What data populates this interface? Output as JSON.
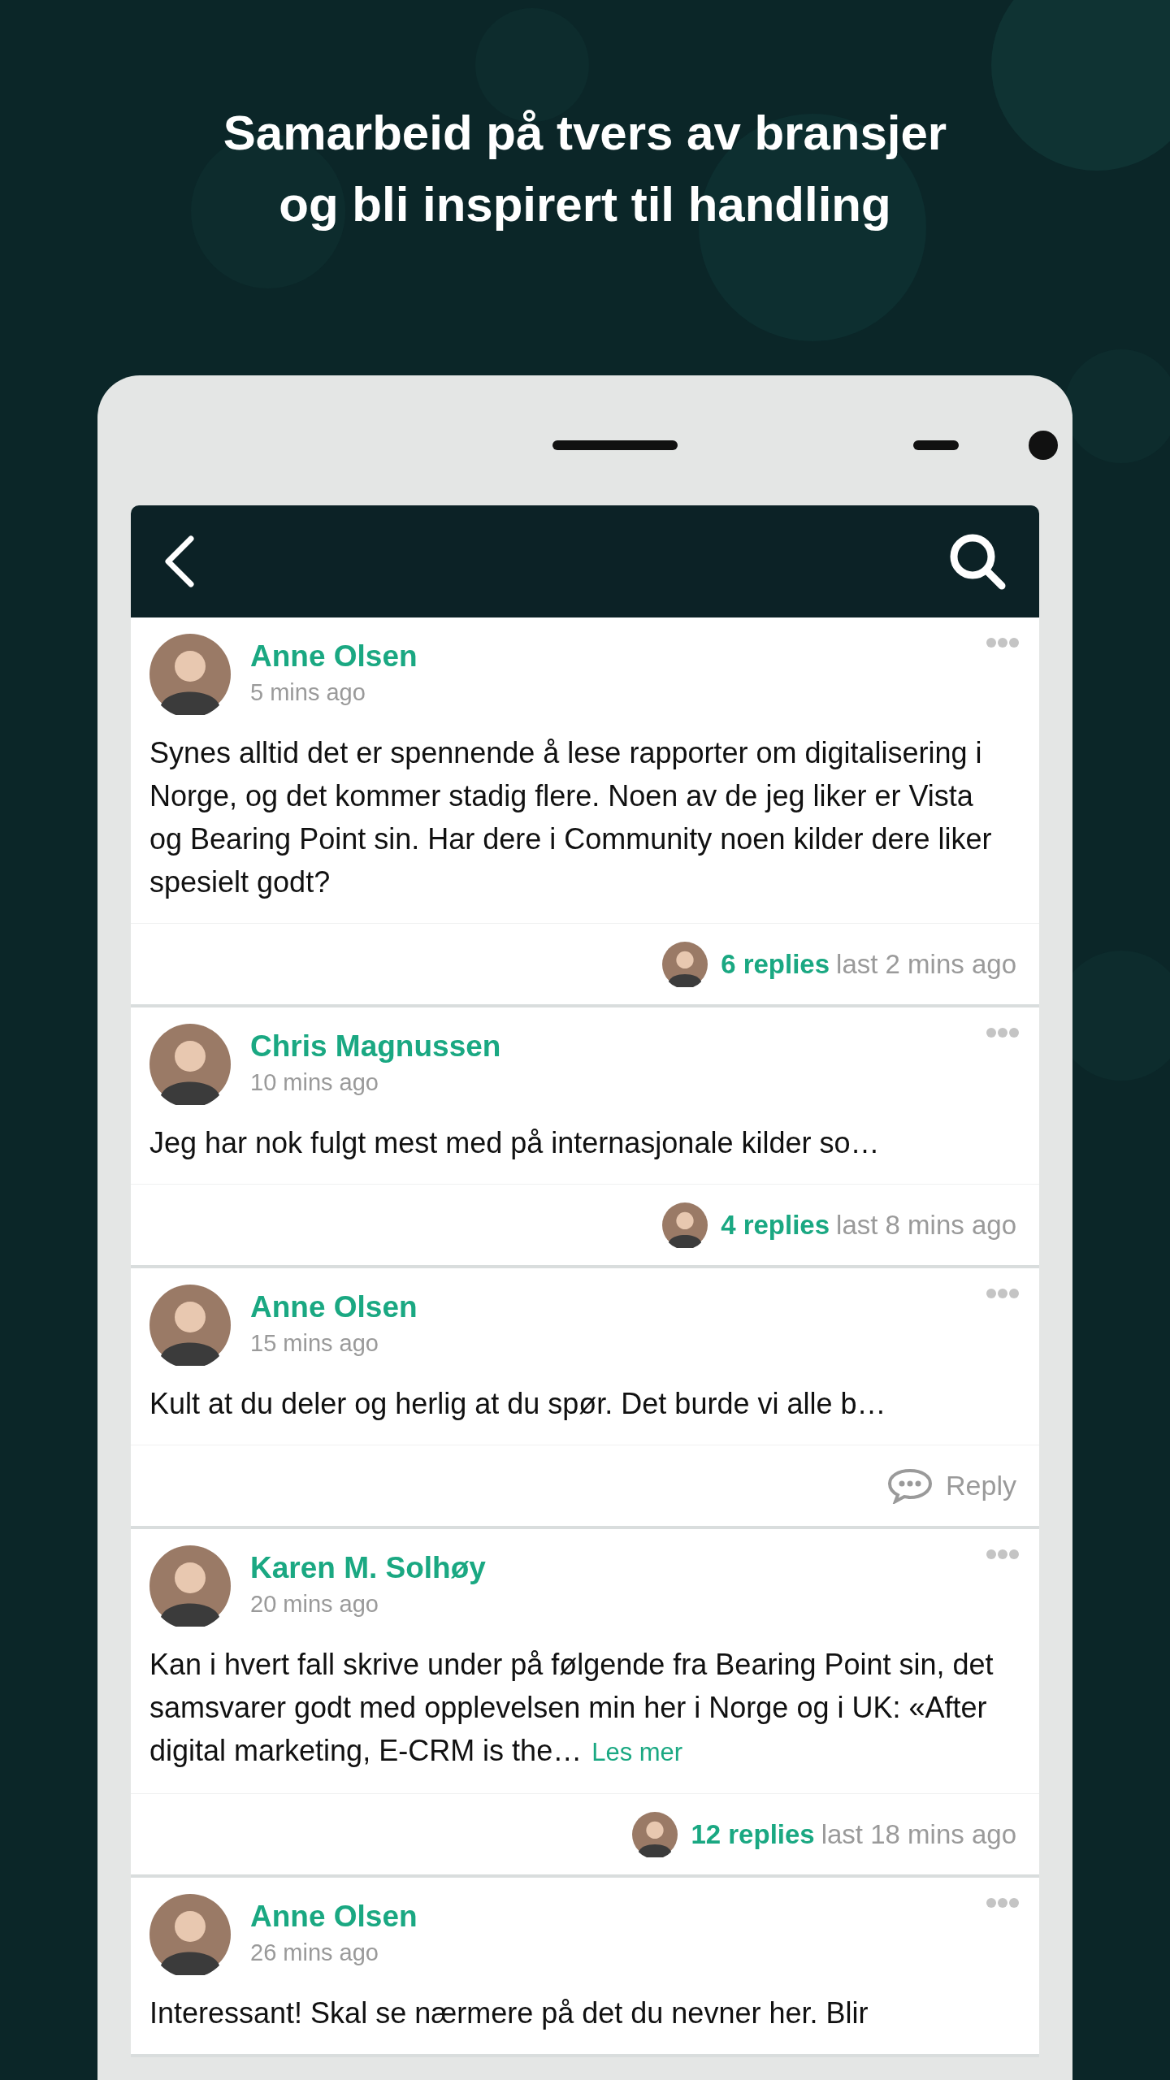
{
  "headline_lines": [
    "Samarbeid på tvers av bransjer",
    "og bli inspirert til handling"
  ],
  "posts": [
    {
      "author": "Anne Olsen",
      "time": "5 mins ago",
      "text": "Synes alltid det er spennende å lese rapporter om digitalisering i Norge, og det kommer stadig flere. Noen av de jeg liker er Vista og Bearing Point sin. Har dere i Community noen kilder dere liker spesielt godt?",
      "footer": {
        "kind": "replies",
        "count": "6 replies",
        "last": "last 2 mins ago"
      }
    },
    {
      "author": "Chris Magnussen",
      "time": "10 mins ago",
      "text": "Jeg har nok fulgt mest med på internasjonale kilder so…",
      "footer": {
        "kind": "replies",
        "count": "4 replies",
        "last": "last 8 mins ago"
      }
    },
    {
      "author": "Anne Olsen",
      "time": "15 mins ago",
      "text": "Kult at du deler og herlig at du spør. Det burde vi alle b…",
      "footer": {
        "kind": "reply",
        "label": "Reply"
      }
    },
    {
      "author": "Karen M. Solhøy",
      "time": "20 mins ago",
      "text": "Kan i hvert fall skrive under på følgende fra Bearing Point sin, det samsvarer godt med opplevelsen min her i Norge og i UK: «After digital marketing, E-CRM is the…",
      "more_link": "Les mer",
      "footer": {
        "kind": "replies",
        "count": "12 replies",
        "last": "last 18 mins ago"
      }
    },
    {
      "author": "Anne Olsen",
      "time": "26 mins ago",
      "text": "Interessant! Skal se nærmere på det du nevner her. Blir"
    }
  ]
}
